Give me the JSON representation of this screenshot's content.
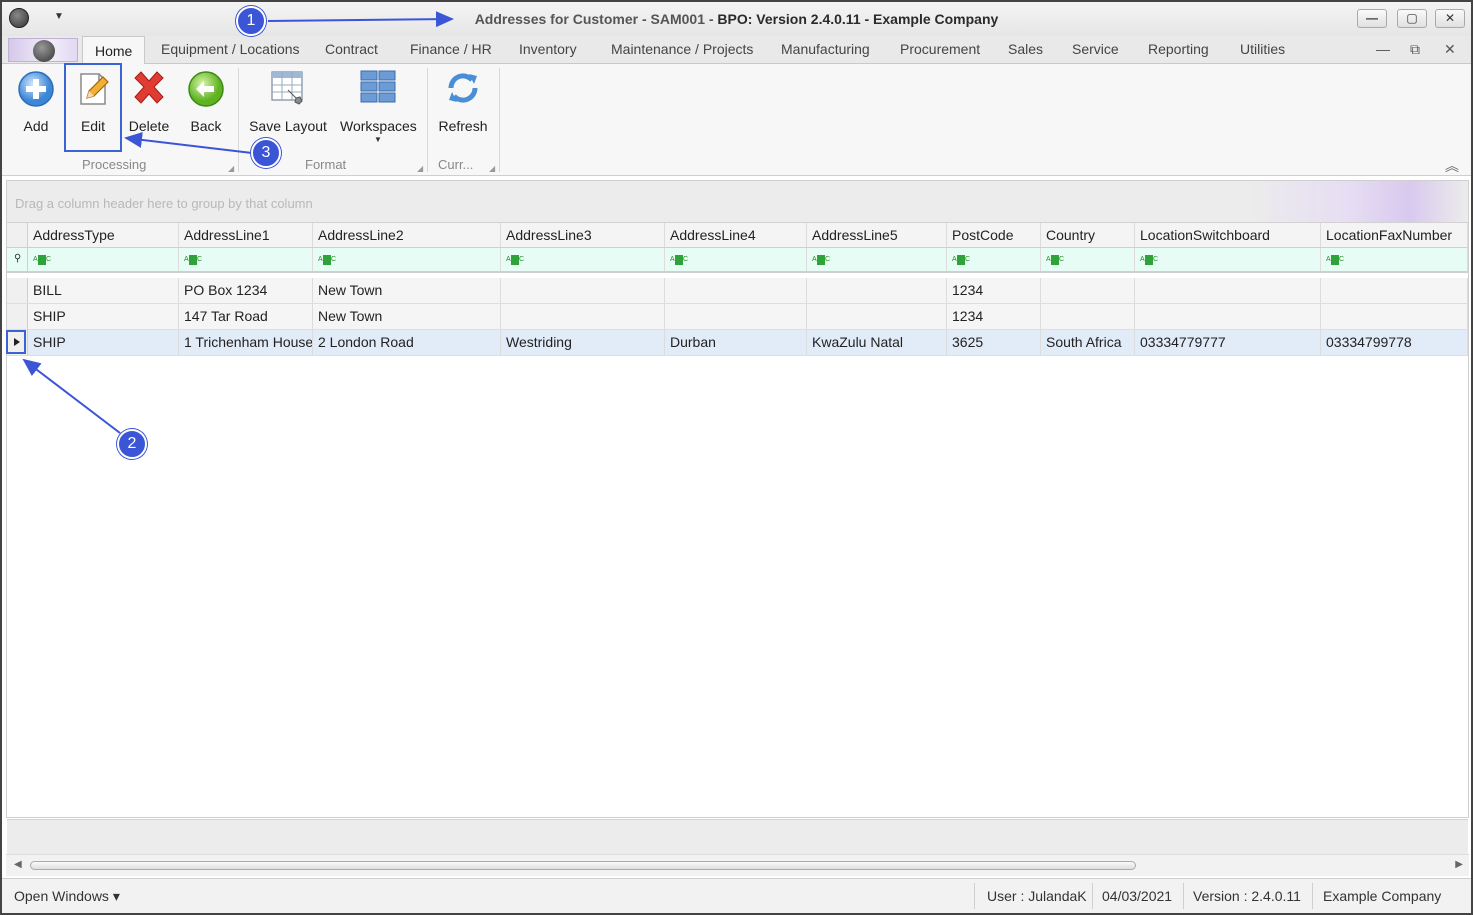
{
  "window": {
    "title_prefix": "Addresses for Customer - SAM001 - ",
    "title_strong": "BPO: Version 2.4.0.11 - Example Company",
    "minimize": "—",
    "maximize": "▢",
    "close": "✕"
  },
  "tabs": [
    "Home",
    "Equipment / Locations",
    "Contract",
    "Finance / HR",
    "Inventory",
    "Maintenance / Projects",
    "Manufacturing",
    "Procurement",
    "Sales",
    "Service",
    "Reporting",
    "Utilities"
  ],
  "mdi": {
    "minimize": "—",
    "restore": "⧉",
    "close": "✕"
  },
  "ribbon": {
    "buttons": {
      "add": "Add",
      "edit": "Edit",
      "delete": "Delete",
      "back": "Back",
      "save_layout": "Save Layout",
      "workspaces": "Workspaces",
      "refresh": "Refresh"
    },
    "groups": {
      "processing": "Processing",
      "format": "Format",
      "current": "Curr..."
    }
  },
  "grid": {
    "group_panel_hint": "Drag a column header here to group by that column",
    "columns": [
      "AddressType",
      "AddressLine1",
      "AddressLine2",
      "AddressLine3",
      "AddressLine4",
      "AddressLine5",
      "PostCode",
      "Country",
      "LocationSwitchboard",
      "LocationFaxNumber"
    ],
    "rows": [
      [
        "BILL",
        "PO Box 1234",
        "New Town",
        "",
        "",
        "",
        "1234",
        "",
        "",
        ""
      ],
      [
        "SHIP",
        "147 Tar Road",
        "New Town",
        "",
        "",
        "",
        "1234",
        "",
        "",
        ""
      ],
      [
        "SHIP",
        "1 Trichenham House",
        "2 London Road",
        "Westriding",
        "Durban",
        "KwaZulu Natal",
        "3625",
        "South Africa",
        "03334779777",
        "03334799778"
      ]
    ],
    "focused_row": 3
  },
  "statusbar": {
    "open_windows": "Open Windows ▾",
    "user": "User : JulandaK",
    "date": "04/03/2021",
    "version": "Version : 2.4.0.11",
    "company": "Example Company"
  },
  "callouts": [
    "1",
    "2",
    "3"
  ]
}
